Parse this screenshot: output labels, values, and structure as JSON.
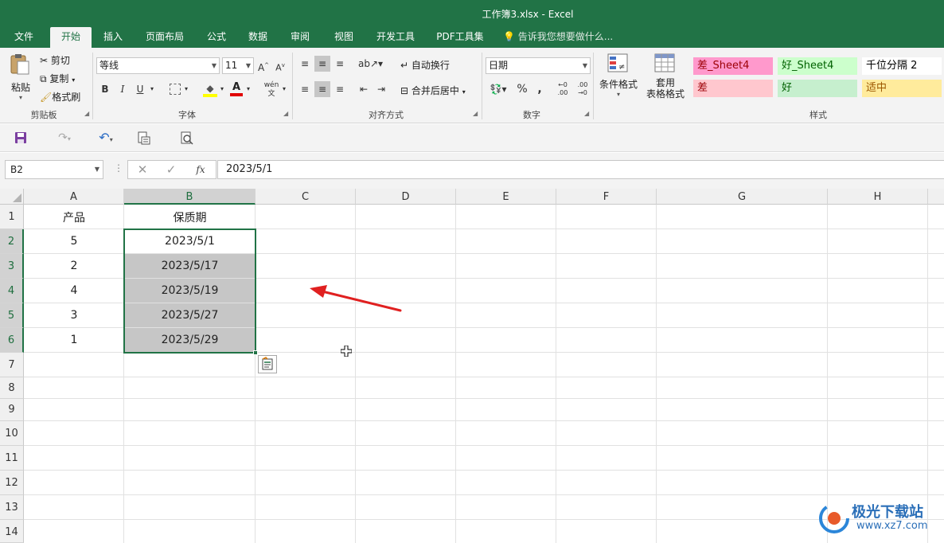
{
  "window": {
    "title": "工作簿3.xlsx - Excel"
  },
  "tabs": [
    {
      "label": "文件"
    },
    {
      "label": "开始"
    },
    {
      "label": "插入"
    },
    {
      "label": "页面布局"
    },
    {
      "label": "公式"
    },
    {
      "label": "数据"
    },
    {
      "label": "审阅"
    },
    {
      "label": "视图"
    },
    {
      "label": "开发工具"
    },
    {
      "label": "PDF工具集"
    }
  ],
  "tell_me": "告诉我您想要做什么...",
  "ribbon": {
    "clipboard": {
      "paste": "粘贴",
      "cut": "剪切",
      "copy": "复制",
      "format_painter": "格式刷",
      "group": "剪贴板"
    },
    "font": {
      "name": "等线",
      "size": "11",
      "group": "字体",
      "bold": "B",
      "italic": "I",
      "underline": "U"
    },
    "alignment": {
      "wrap_text": "自动换行",
      "merge_center": "合并后居中",
      "group": "对齐方式"
    },
    "number": {
      "format": "日期",
      "group": "数字",
      "percent": "%",
      "comma": ","
    },
    "styles": {
      "conditional": "条件格式",
      "table_format_line1": "套用",
      "table_format_line2": "表格格式",
      "group": "样式",
      "cells": [
        {
          "label": "差_Sheet4",
          "bg": "#ff99cc",
          "color": "#9c0006"
        },
        {
          "label": "好_Sheet4",
          "bg": "#ccffcc",
          "color": "#006100"
        },
        {
          "label": "千位分隔 2",
          "bg": "#ffffff",
          "color": "#000000"
        },
        {
          "label": "差",
          "bg": "#ffc7ce",
          "color": "#9c0006"
        },
        {
          "label": "好",
          "bg": "#c6efce",
          "color": "#006100"
        },
        {
          "label": "适中",
          "bg": "#ffeb9c",
          "color": "#9c5700"
        }
      ]
    }
  },
  "formula_bar": {
    "name_box": "B2",
    "formula": "2023/5/1",
    "fx": "fx"
  },
  "columns": [
    "A",
    "B",
    "C",
    "D",
    "E",
    "F",
    "G",
    "H"
  ],
  "rows": [
    "1",
    "2",
    "3",
    "4",
    "5",
    "6",
    "7",
    "8",
    "9",
    "10",
    "11",
    "12",
    "13",
    "14"
  ],
  "cells": {
    "A1": "产品",
    "B1": "保质期",
    "A2": "5",
    "B2": "2023/5/1",
    "A3": "2",
    "B3": "2023/5/17",
    "A4": "4",
    "B4": "2023/5/19",
    "A5": "3",
    "B5": "2023/5/27",
    "A6": "1",
    "B6": "2023/5/29"
  },
  "selection": {
    "active_cell": "B2",
    "range": "B2:B6"
  },
  "watermark": {
    "line1": "极光下载站",
    "line2": "www.xz7.com"
  },
  "colors": {
    "excel_green": "#217346",
    "arrow_red": "#e02020"
  }
}
